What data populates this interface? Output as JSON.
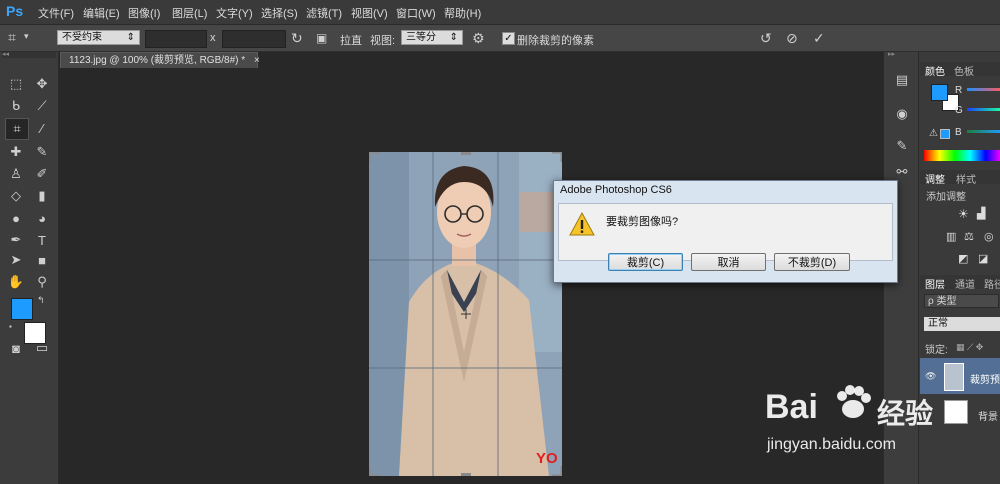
{
  "app": {
    "logo": "Ps"
  },
  "menu": [
    "文件(F)",
    "编辑(E)",
    "图像(I)",
    "图层(L)",
    "文字(Y)",
    "选择(S)",
    "滤镜(T)",
    "视图(V)",
    "窗口(W)",
    "帮助(H)"
  ],
  "options": {
    "ratio_select": "不受约束",
    "x_label": "x",
    "straighten_label": "拉直",
    "view_label": "视图:",
    "view_select": "三等分",
    "delete_cropped_label": "删除裁剪的像素",
    "delete_cropped_checked": true
  },
  "document": {
    "tab_title": "1123.jpg @ 100% (裁剪预览, RGB/8#) *",
    "close": "×",
    "watermark_text": "YO"
  },
  "panels": {
    "color_tabs": [
      "颜色",
      "色板"
    ],
    "color_channels": [
      "R",
      "G",
      "B"
    ],
    "adjust_tabs": [
      "调整",
      "样式"
    ],
    "adjust_title": "添加调整",
    "layer_tabs": [
      "图层",
      "通道",
      "路径"
    ],
    "layer_filter": "ρ 类型",
    "blend_mode": "正常",
    "lock_label": "锁定:",
    "layers": [
      {
        "name": "裁剪预览"
      },
      {
        "name": "背景"
      }
    ],
    "foreground_color": "#1e9bff",
    "background_color": "#ffffff"
  },
  "dialog": {
    "title": "Adobe Photoshop CS6",
    "message": "要裁剪图像吗?",
    "buttons": [
      "裁剪(C)",
      "取消",
      "不裁剪(D)"
    ]
  },
  "watermark": {
    "brand": "Bai",
    "brand_cn": "经验",
    "url": "jingyan.baidu.com"
  }
}
